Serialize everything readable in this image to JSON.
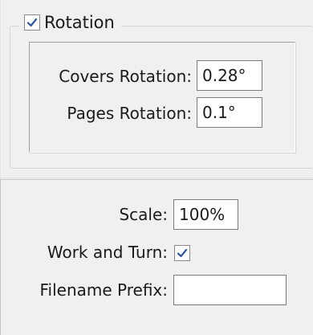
{
  "rotation_group": {
    "checkbox_checked": true,
    "label": "Rotation",
    "covers_rotation": {
      "label": "Covers Rotation:",
      "value": "0.28°"
    },
    "pages_rotation": {
      "label": "Pages Rotation:",
      "value": "0.1°"
    }
  },
  "layout_options": {
    "scale": {
      "label": "Scale:",
      "value": "100%"
    },
    "work_and_turn": {
      "label": "Work and Turn:",
      "checked": true
    },
    "filename_prefix": {
      "label": "Filename Prefix:",
      "value": ""
    }
  },
  "colors": {
    "accent_check": "#2b56a6"
  }
}
